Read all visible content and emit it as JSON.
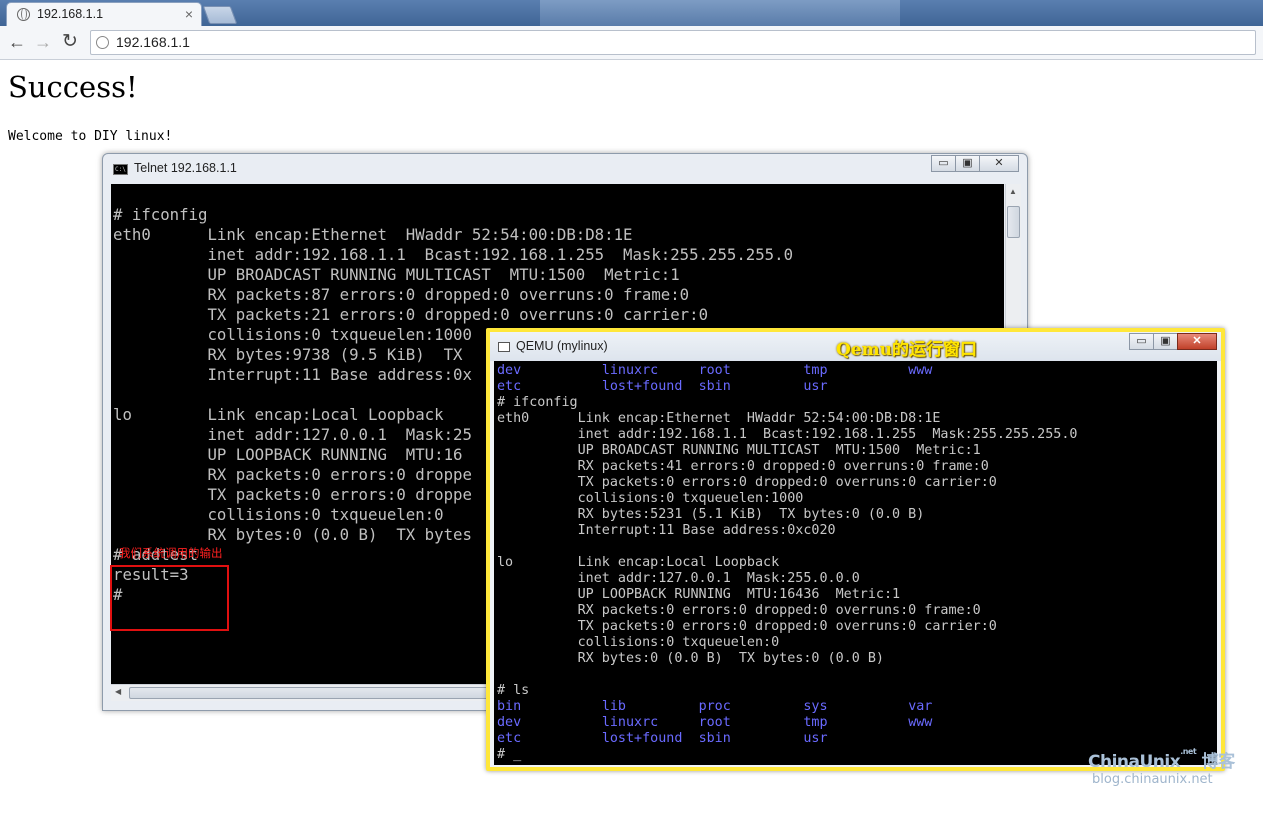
{
  "browser": {
    "tab_title": "192.168.1.1",
    "tab_close": "×",
    "address": "192.168.1.1",
    "back": "←",
    "forward": "→",
    "reload": "↻"
  },
  "page": {
    "heading": "Success!",
    "text": "Welcome to DIY linux!"
  },
  "telnet": {
    "title": "Telnet 192.168.1.1",
    "buttons": {
      "minimize": "▭",
      "maximize": "▣",
      "close": "✕"
    },
    "lines": [
      "# ifconfig",
      "eth0      Link encap:Ethernet  HWaddr 52:54:00:DB:D8:1E",
      "          inet addr:192.168.1.1  Bcast:192.168.1.255  Mask:255.255.255.0",
      "          UP BROADCAST RUNNING MULTICAST  MTU:1500  Metric:1",
      "          RX packets:87 errors:0 dropped:0 overruns:0 frame:0",
      "          TX packets:21 errors:0 dropped:0 overruns:0 carrier:0",
      "          collisions:0 txqueuelen:1000",
      "          RX bytes:9738 (9.5 KiB)  TX",
      "          Interrupt:11 Base address:0x",
      "",
      "lo        Link encap:Local Loopback",
      "          inet addr:127.0.0.1  Mask:25",
      "          UP LOOPBACK RUNNING  MTU:16",
      "          RX packets:0 errors:0 droppe",
      "          TX packets:0 errors:0 droppe",
      "          collisions:0 txqueuelen:0",
      "          RX bytes:0 (0.0 B)  TX bytes",
      "# addtest",
      "result=3",
      "#"
    ]
  },
  "annotation": {
    "label": "我们系统调用的输出"
  },
  "qemu": {
    "title": "QEMU (mylinux)",
    "caption": "Qemu的运行窗口",
    "buttons": {
      "minimize": "▭",
      "maximize": "▣",
      "close": "✕"
    },
    "ls_top": [
      [
        "dev",
        "linuxrc",
        "root",
        "tmp",
        "www"
      ],
      [
        "etc",
        "lost+found",
        "sbin",
        "usr"
      ]
    ],
    "lines": [
      "# ifconfig",
      "eth0      Link encap:Ethernet  HWaddr 52:54:00:DB:D8:1E",
      "          inet addr:192.168.1.1  Bcast:192.168.1.255  Mask:255.255.255.0",
      "          UP BROADCAST RUNNING MULTICAST  MTU:1500  Metric:1",
      "          RX packets:41 errors:0 dropped:0 overruns:0 frame:0",
      "          TX packets:0 errors:0 dropped:0 overruns:0 carrier:0",
      "          collisions:0 txqueuelen:1000",
      "          RX bytes:5231 (5.1 KiB)  TX bytes:0 (0.0 B)",
      "          Interrupt:11 Base address:0xc020",
      "",
      "lo        Link encap:Local Loopback",
      "          inet addr:127.0.0.1  Mask:255.0.0.0",
      "          UP LOOPBACK RUNNING  MTU:16436  Metric:1",
      "          RX packets:0 errors:0 dropped:0 overruns:0 frame:0",
      "          TX packets:0 errors:0 dropped:0 overruns:0 carrier:0",
      "          collisions:0 txqueuelen:0",
      "          RX bytes:0 (0.0 B)  TX bytes:0 (0.0 B)",
      "",
      "# ls"
    ],
    "ls_bottom": [
      [
        "bin",
        "lib",
        "proc",
        "sys",
        "var"
      ],
      [
        "dev",
        "linuxrc",
        "root",
        "tmp",
        "www"
      ],
      [
        "etc",
        "lost+found",
        "sbin",
        "usr"
      ]
    ],
    "prompt": "# ",
    "cursor": "_"
  },
  "watermark": {
    "brand": "ChinaUnix",
    "brand_sup": ".net",
    "brand_suffix": "博客",
    "url": "blog.chinaunix.net"
  },
  "colors": {
    "annotation": "#e01010",
    "qemu_border": "#ffe73a",
    "qemu_dir_blue": "#6a6aff",
    "terminal_bg": "#000000"
  }
}
